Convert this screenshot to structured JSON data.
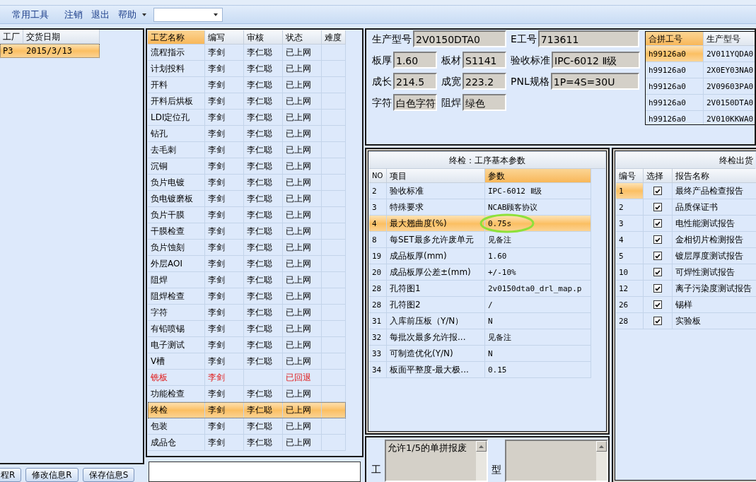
{
  "menu": [
    {
      "label": "常用工具"
    },
    {
      "label": "注销"
    },
    {
      "label": "退出"
    },
    {
      "label": "帮助"
    }
  ],
  "orders": {
    "columns": [
      "工厂",
      "交货日期"
    ],
    "rows": [
      {
        "cells": [
          "P3",
          "2015/3/13"
        ],
        "selected": true
      }
    ]
  },
  "left_buttons": [
    "程R",
    "修改信息R",
    "保存信息S"
  ],
  "processes": {
    "columns": [
      "工艺名称",
      "编写",
      "审核",
      "状态",
      "难度"
    ],
    "rows": [
      {
        "cells": [
          "流程指示",
          "李剑",
          "李仁聪",
          "已上网"
        ],
        "returned": false,
        "selected": false
      },
      {
        "cells": [
          "计划投料",
          "李剑",
          "李仁聪",
          "已上网"
        ],
        "returned": false,
        "selected": false
      },
      {
        "cells": [
          "开料",
          "李剑",
          "李仁聪",
          "已上网"
        ],
        "returned": false,
        "selected": false
      },
      {
        "cells": [
          "开料后烘板",
          "李剑",
          "李仁聪",
          "已上网"
        ],
        "returned": false,
        "selected": false
      },
      {
        "cells": [
          "LDI定位孔",
          "李剑",
          "李仁聪",
          "已上网"
        ],
        "returned": false,
        "selected": false
      },
      {
        "cells": [
          "钻孔",
          "李剑",
          "李仁聪",
          "已上网"
        ],
        "returned": false,
        "selected": false
      },
      {
        "cells": [
          "去毛刺",
          "李剑",
          "李仁聪",
          "已上网"
        ],
        "returned": false,
        "selected": false
      },
      {
        "cells": [
          "沉铜",
          "李剑",
          "李仁聪",
          "已上网"
        ],
        "returned": false,
        "selected": false
      },
      {
        "cells": [
          "负片电镀",
          "李剑",
          "李仁聪",
          "已上网"
        ],
        "returned": false,
        "selected": false
      },
      {
        "cells": [
          "负电镀磨板",
          "李剑",
          "李仁聪",
          "已上网"
        ],
        "returned": false,
        "selected": false
      },
      {
        "cells": [
          "负片干膜",
          "李剑",
          "李仁聪",
          "已上网"
        ],
        "returned": false,
        "selected": false
      },
      {
        "cells": [
          "干膜检查",
          "李剑",
          "李仁聪",
          "已上网"
        ],
        "returned": false,
        "selected": false
      },
      {
        "cells": [
          "负片蚀刻",
          "李剑",
          "李仁聪",
          "已上网"
        ],
        "returned": false,
        "selected": false
      },
      {
        "cells": [
          "外层AOI",
          "李剑",
          "李仁聪",
          "已上网"
        ],
        "returned": false,
        "selected": false
      },
      {
        "cells": [
          "阻焊",
          "李剑",
          "李仁聪",
          "已上网"
        ],
        "returned": false,
        "selected": false
      },
      {
        "cells": [
          "阻焊检查",
          "李剑",
          "李仁聪",
          "已上网"
        ],
        "returned": false,
        "selected": false
      },
      {
        "cells": [
          "字符",
          "李剑",
          "李仁聪",
          "已上网"
        ],
        "returned": false,
        "selected": false
      },
      {
        "cells": [
          "有铅喷锡",
          "李剑",
          "李仁聪",
          "已上网"
        ],
        "returned": false,
        "selected": false
      },
      {
        "cells": [
          "电子测试",
          "李剑",
          "李仁聪",
          "已上网"
        ],
        "returned": false,
        "selected": false
      },
      {
        "cells": [
          "V槽",
          "李剑",
          "李仁聪",
          "已上网"
        ],
        "returned": false,
        "selected": false
      },
      {
        "cells": [
          "铣板",
          "李剑",
          "",
          "已回退"
        ],
        "returned": true,
        "selected": false
      },
      {
        "cells": [
          "功能检查",
          "李剑",
          "李仁聪",
          "已上网"
        ],
        "returned": false,
        "selected": false
      },
      {
        "cells": [
          "终检",
          "李剑",
          "李仁聪",
          "已上网"
        ],
        "returned": false,
        "selected": true
      },
      {
        "cells": [
          "包装",
          "李剑",
          "李仁聪",
          "已上网"
        ],
        "returned": false,
        "selected": false
      },
      {
        "cells": [
          "成品仓",
          "李剑",
          "李仁聪",
          "已上网"
        ],
        "returned": false,
        "selected": false
      }
    ]
  },
  "info_rows": [
    [
      {
        "label": "生产型号",
        "value": "2V0150DTA0"
      },
      {
        "label": "E工号",
        "value": "713611"
      }
    ],
    [
      {
        "label": "板厚",
        "value": "1.60"
      },
      {
        "label": "板材",
        "value": "S1141"
      },
      {
        "label": "验收标准",
        "value": "IPC-6012 Ⅱ级"
      }
    ],
    [
      {
        "label": "成长",
        "value": "214.5"
      },
      {
        "label": "成宽",
        "value": "223.2"
      },
      {
        "label": "PNL规格",
        "value": "1P=4S=30U"
      }
    ],
    [
      {
        "label": "字符",
        "value": "白色字符"
      },
      {
        "label": "阻焊",
        "value": "绿色"
      }
    ]
  ],
  "merged": {
    "columns": [
      "合拼工号",
      "生产型号"
    ],
    "rows": [
      {
        "cells": [
          "h99126a0",
          "2V011YQDA0"
        ],
        "selected": true
      },
      {
        "cells": [
          "h99126a0",
          "2X0EY03NA0"
        ],
        "selected": false
      },
      {
        "cells": [
          "h99126a0",
          "2V09603PA0"
        ],
        "selected": false
      },
      {
        "cells": [
          "h99126a0",
          "2V0150DTA0"
        ],
        "selected": false
      },
      {
        "cells": [
          "h99126a0",
          "2V010KKWA0"
        ],
        "selected": false
      }
    ]
  },
  "params": {
    "title": "终检：工序基本参数",
    "columns": [
      "NO",
      "项目",
      "参数"
    ],
    "rows": [
      {
        "cells": [
          "2",
          "验收标准",
          "IPC-6012 Ⅱ级"
        ],
        "selected": false,
        "circled": false
      },
      {
        "cells": [
          "3",
          "特殊要求",
          "NCAB顾客协议"
        ],
        "selected": false,
        "circled": false
      },
      {
        "cells": [
          "4",
          "最大翘曲度(%)",
          "0.75s"
        ],
        "selected": true,
        "circled": true
      },
      {
        "cells": [
          "8",
          "每SET最多允许废单元",
          "见备注"
        ],
        "selected": false,
        "circled": false
      },
      {
        "cells": [
          "19",
          "成品板厚(mm)",
          "1.60"
        ],
        "selected": false,
        "circled": false
      },
      {
        "cells": [
          "20",
          "成品板厚公差±(mm)",
          "+/-10%"
        ],
        "selected": false,
        "circled": false
      },
      {
        "cells": [
          "28",
          "孔符图1",
          "2v0150dta0_drl_map.p"
        ],
        "selected": false,
        "circled": false
      },
      {
        "cells": [
          "28",
          "孔符图2",
          "/"
        ],
        "selected": false,
        "circled": false
      },
      {
        "cells": [
          "31",
          "入库前压板（Y/N）",
          "N"
        ],
        "selected": false,
        "circled": false
      },
      {
        "cells": [
          "32",
          "每批次最多允许报...",
          "见备注"
        ],
        "selected": false,
        "circled": false
      },
      {
        "cells": [
          "33",
          "可制造优化(Y/N)",
          "N"
        ],
        "selected": false,
        "circled": false
      },
      {
        "cells": [
          "34",
          "板面平整度-最大极...",
          "0.15"
        ],
        "selected": false,
        "circled": false
      }
    ]
  },
  "notes": [
    {
      "label": "工",
      "value": "允许1/5的单拼报废"
    },
    {
      "label": "型"
    }
  ],
  "reports": {
    "title": "终检出货",
    "columns": [
      "编号",
      "选择",
      "报告名称"
    ],
    "rows": [
      {
        "no": "1",
        "checked": true,
        "name": "最终产品检查报告",
        "selected": true
      },
      {
        "no": "2",
        "checked": true,
        "name": "品质保证书",
        "selected": false
      },
      {
        "no": "3",
        "checked": true,
        "name": "电性能测试报告",
        "selected": false
      },
      {
        "no": "4",
        "checked": true,
        "name": "金相切片检测报告",
        "selected": false
      },
      {
        "no": "5",
        "checked": true,
        "name": "镀层厚度测试报告",
        "selected": false
      },
      {
        "no": "10",
        "checked": true,
        "name": "可焊性测试报告",
        "selected": false
      },
      {
        "no": "12",
        "checked": true,
        "name": "离子污染度测试报告",
        "selected": false
      },
      {
        "no": "26",
        "checked": true,
        "name": "锡样",
        "selected": false
      },
      {
        "no": "28",
        "checked": true,
        "name": "实验板",
        "selected": false
      }
    ]
  }
}
